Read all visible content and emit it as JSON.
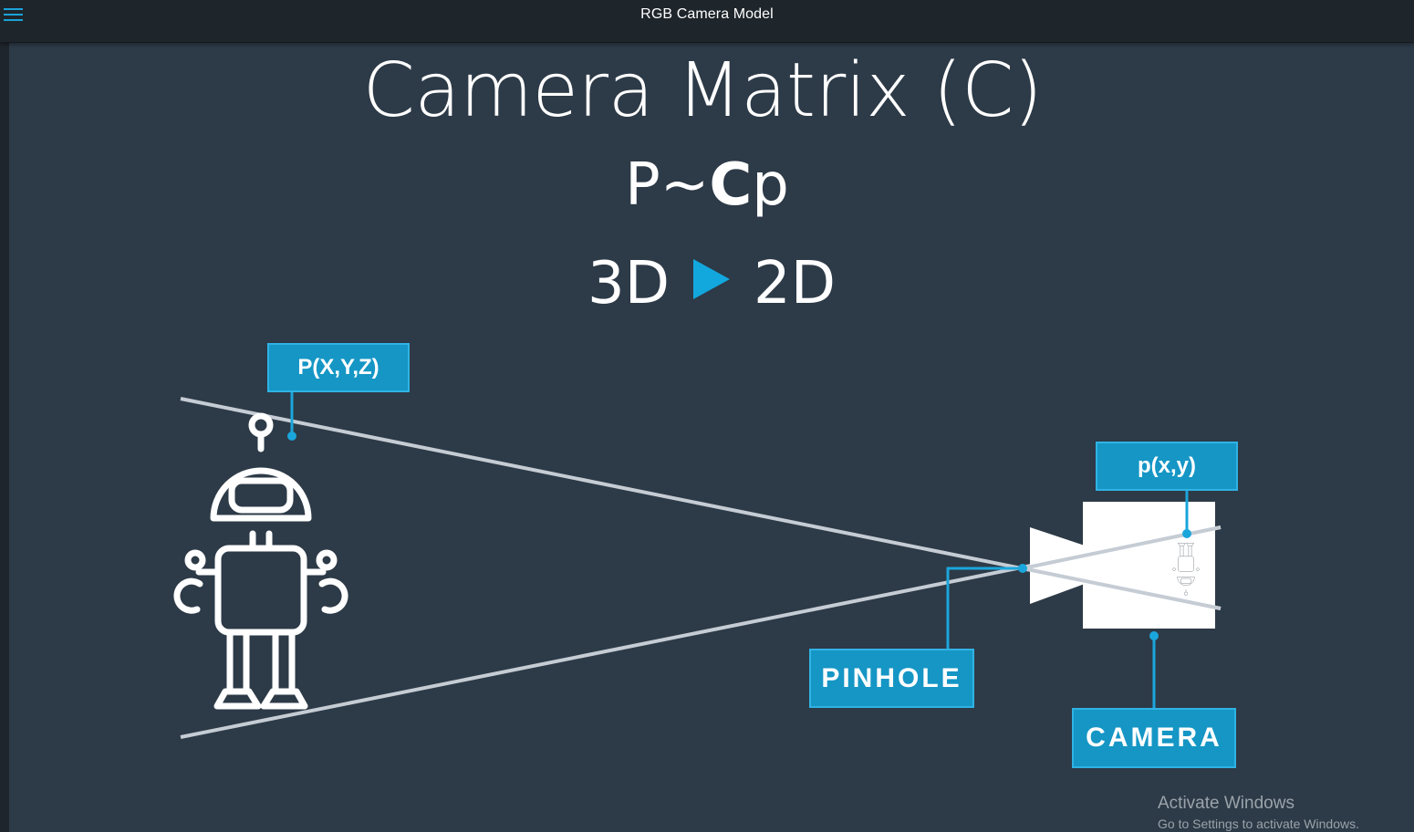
{
  "window": {
    "title": "RGB Camera Model",
    "menu_icon": "hamburger-menu-icon"
  },
  "slide": {
    "title": "Camera Matrix (C)",
    "formula": {
      "left": "P~",
      "bold": "C",
      "right": "p"
    },
    "dimension": {
      "from": "3D",
      "to": "2D",
      "arrow_icon": "play-triangle-icon"
    },
    "labels": {
      "world_point": "P(X,Y,Z)",
      "image_point": "p(x,y)",
      "pinhole": "PINHOLE",
      "camera": "CAMERA"
    }
  },
  "watermark": {
    "line1": "Activate Windows",
    "line2": "Go to Settings to activate Windows."
  },
  "colors": {
    "background": "#2d3a47",
    "topbar": "#1e252b",
    "accent": "#1596c5",
    "lines": "#c5ccd4",
    "figure": "#ffffff"
  }
}
